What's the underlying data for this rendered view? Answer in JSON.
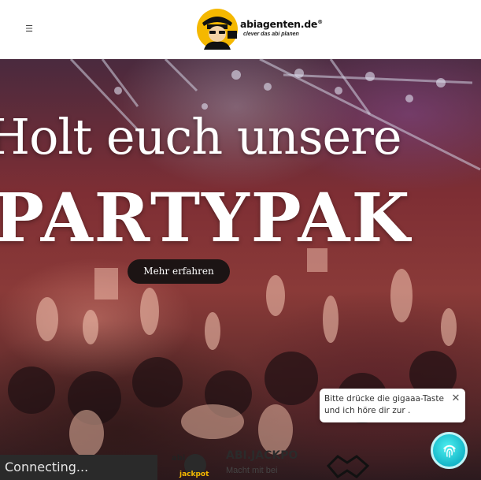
{
  "header": {
    "menu_icon": "menu-icon",
    "logo_name": "abiagenten.de",
    "logo_registered": "®",
    "logo_tagline": "clever das abi planen"
  },
  "hero": {
    "headline": "Holt euch unsere",
    "headline_big": "PARTYPAK",
    "cta_label": "Mehr erfahren"
  },
  "promo": {
    "logo_text_top": "abi",
    "logo_text_bottom": "jackpot",
    "title": "ABI.JACKPO",
    "subtitle": "Macht mit bei"
  },
  "chat": {
    "message": "Bitte drücke die gigaaa-Taste und ich höre dir zur .",
    "close_label": "✕",
    "fab_icon": "fingerprint-icon"
  },
  "status": {
    "text": "Connecting..."
  },
  "colors": {
    "accent": "#14b6c8",
    "cta_bg": "#1c1414",
    "logo_yellow": "#f5b800"
  }
}
